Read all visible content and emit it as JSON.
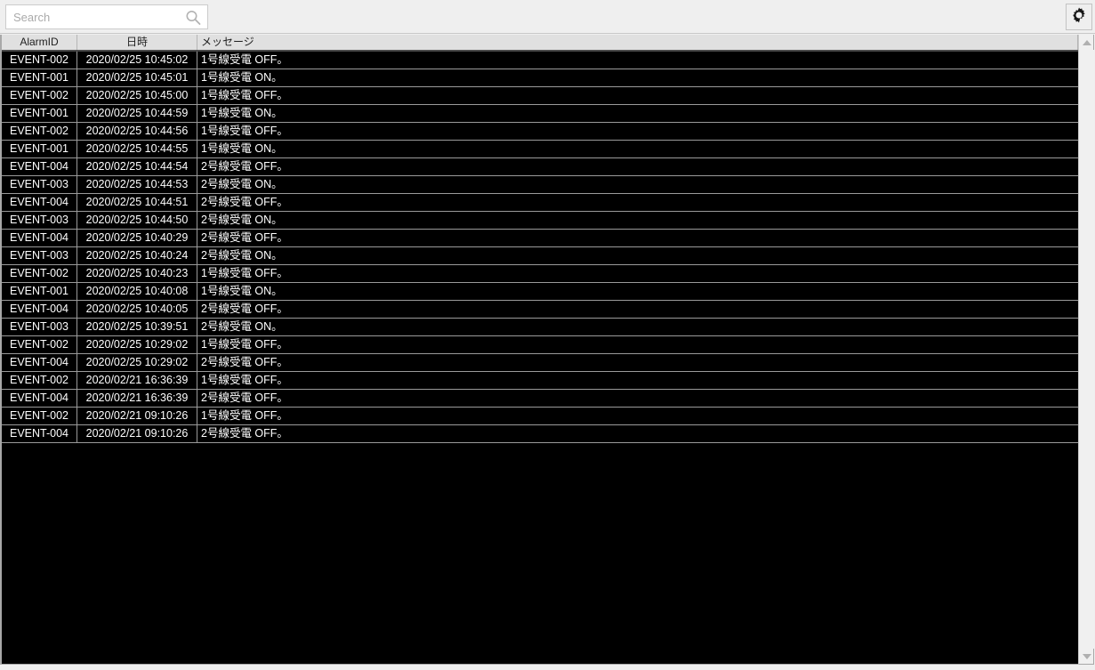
{
  "toolbar": {
    "search": {
      "placeholder": "Search",
      "value": "",
      "icon": "search-icon"
    },
    "settings": {
      "icon": "gear-icon",
      "label": ""
    }
  },
  "colors": {
    "window_background": "#efefef",
    "grid_background": "#000000",
    "grid_text": "#ffffff",
    "header_background": "#e0e0e0",
    "header_text": "#202020",
    "grid_line": "#9a9a9a",
    "border": "#a8a8a8",
    "placeholder": "#aaaaaa"
  },
  "table": {
    "columns": [
      {
        "key": "alarm_id",
        "label": "AlarmID",
        "align": "center"
      },
      {
        "key": "datetime",
        "label": "日時",
        "align": "center"
      },
      {
        "key": "message",
        "label": "メッセージ",
        "align": "left"
      }
    ],
    "row_count": 22,
    "rows": [
      {
        "alarm_id": "EVENT-002",
        "datetime": "2020/02/25 10:45:02",
        "message": "1号線受電 OFF。"
      },
      {
        "alarm_id": "EVENT-001",
        "datetime": "2020/02/25 10:45:01",
        "message": "1号線受電 ON。"
      },
      {
        "alarm_id": "EVENT-002",
        "datetime": "2020/02/25 10:45:00",
        "message": "1号線受電 OFF。"
      },
      {
        "alarm_id": "EVENT-001",
        "datetime": "2020/02/25 10:44:59",
        "message": "1号線受電 ON。"
      },
      {
        "alarm_id": "EVENT-002",
        "datetime": "2020/02/25 10:44:56",
        "message": "1号線受電 OFF。"
      },
      {
        "alarm_id": "EVENT-001",
        "datetime": "2020/02/25 10:44:55",
        "message": "1号線受電 ON。"
      },
      {
        "alarm_id": "EVENT-004",
        "datetime": "2020/02/25 10:44:54",
        "message": "2号線受電 OFF。"
      },
      {
        "alarm_id": "EVENT-003",
        "datetime": "2020/02/25 10:44:53",
        "message": "2号線受電 ON。"
      },
      {
        "alarm_id": "EVENT-004",
        "datetime": "2020/02/25 10:44:51",
        "message": "2号線受電 OFF。"
      },
      {
        "alarm_id": "EVENT-003",
        "datetime": "2020/02/25 10:44:50",
        "message": "2号線受電 ON。"
      },
      {
        "alarm_id": "EVENT-004",
        "datetime": "2020/02/25 10:40:29",
        "message": "2号線受電 OFF。"
      },
      {
        "alarm_id": "EVENT-003",
        "datetime": "2020/02/25 10:40:24",
        "message": "2号線受電 ON。"
      },
      {
        "alarm_id": "EVENT-002",
        "datetime": "2020/02/25 10:40:23",
        "message": "1号線受電 OFF。"
      },
      {
        "alarm_id": "EVENT-001",
        "datetime": "2020/02/25 10:40:08",
        "message": "1号線受電 ON。"
      },
      {
        "alarm_id": "EVENT-004",
        "datetime": "2020/02/25 10:40:05",
        "message": "2号線受電 OFF。"
      },
      {
        "alarm_id": "EVENT-003",
        "datetime": "2020/02/25 10:39:51",
        "message": "2号線受電 ON。"
      },
      {
        "alarm_id": "EVENT-002",
        "datetime": "2020/02/25 10:29:02",
        "message": "1号線受電 OFF。"
      },
      {
        "alarm_id": "EVENT-004",
        "datetime": "2020/02/25 10:29:02",
        "message": "2号線受電 OFF。"
      },
      {
        "alarm_id": "EVENT-002",
        "datetime": "2020/02/21 16:36:39",
        "message": "1号線受電 OFF。"
      },
      {
        "alarm_id": "EVENT-004",
        "datetime": "2020/02/21 16:36:39",
        "message": "2号線受電 OFF。"
      },
      {
        "alarm_id": "EVENT-002",
        "datetime": "2020/02/21 09:10:26",
        "message": "1号線受電 OFF。"
      },
      {
        "alarm_id": "EVENT-004",
        "datetime": "2020/02/21 09:10:26",
        "message": "2号線受電 OFF。"
      }
    ]
  },
  "scrollbar": {
    "up_icon": "triangle-up-icon",
    "down_icon": "triangle-down-icon",
    "orientation": "vertical"
  }
}
